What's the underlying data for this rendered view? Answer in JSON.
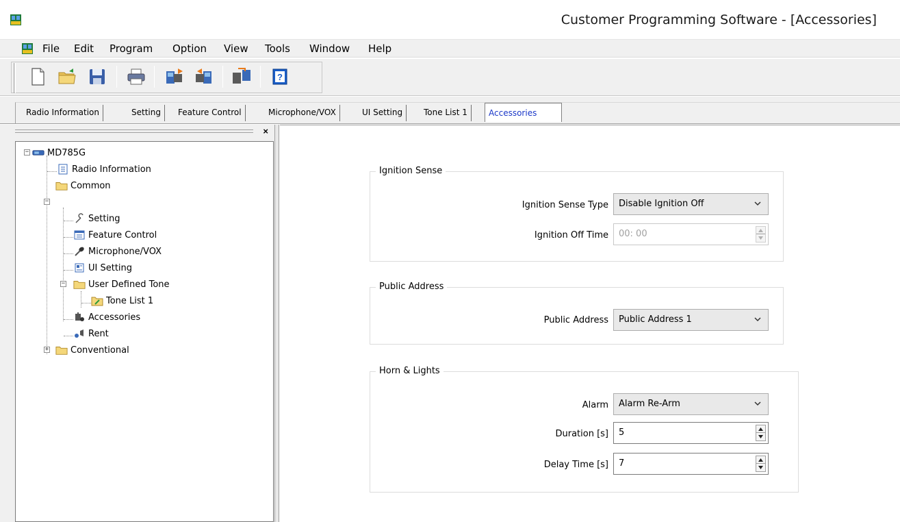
{
  "window": {
    "title": "Customer Programming Software - [Accessories]"
  },
  "menu": [
    "File",
    "Edit",
    "Program",
    "Option",
    "View",
    "Tools",
    "Window",
    "Help"
  ],
  "toolbar": [
    "new-icon",
    "open-folder-icon",
    "save-icon",
    "print-icon",
    "read-radio-icon",
    "write-radio-icon",
    "clone-icon",
    "help-icon"
  ],
  "tabs": [
    "Radio Information",
    "Setting",
    "Feature Control",
    "Microphone/VOX",
    "UI Setting",
    "Tone List 1",
    "Accessories"
  ],
  "active_tab": "Accessories",
  "tree": {
    "root": "MD785G",
    "radio_information": "Radio Information",
    "common": "Common",
    "setting": "Setting",
    "feature_control": "Feature Control",
    "microphone_vox": "Microphone/VOX",
    "ui_setting": "UI Setting",
    "user_defined_tone": "User Defined Tone",
    "tone_list_1": "Tone List 1",
    "accessories": "Accessories",
    "rent": "Rent",
    "conventional": "Conventional"
  },
  "ignition": {
    "title": "Ignition Sense",
    "type_label": "Ignition Sense Type",
    "type_value": "Disable Ignition Off",
    "off_time_label": "Ignition Off Time",
    "off_time_value": "00: 00"
  },
  "public_address": {
    "title": "Public Address",
    "label": "Public Address",
    "value": "Public Address 1"
  },
  "horn_lights": {
    "title": "Horn & Lights",
    "alarm_label": "Alarm",
    "alarm_value": "Alarm Re-Arm",
    "duration_label": "Duration [s]",
    "duration_value": "5",
    "delay_label": "Delay Time [s]",
    "delay_value": "7"
  }
}
